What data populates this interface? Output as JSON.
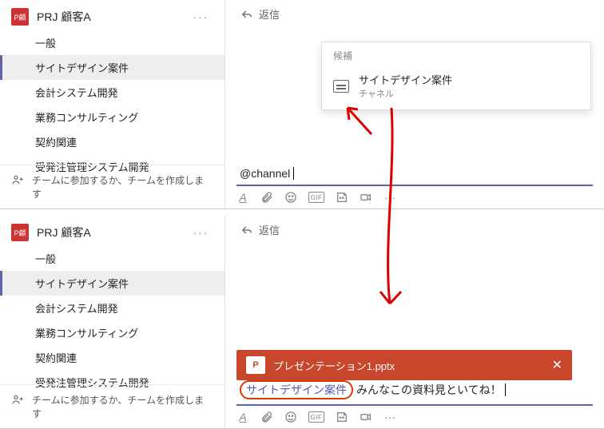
{
  "team": {
    "badge": "P顧",
    "name": "PRJ 顧客A",
    "more": "···"
  },
  "channels": [
    {
      "label": "一般",
      "selected": false
    },
    {
      "label": "サイトデザイン案件",
      "selected": true
    },
    {
      "label": "会計システム開発",
      "selected": false
    },
    {
      "label": "業務コンサルティング",
      "selected": false
    },
    {
      "label": "契約関連",
      "selected": false
    },
    {
      "label": "受発注管理システム開発",
      "selected": false
    }
  ],
  "join_create": "チームに参加するか、チームを作成します",
  "reply_label": "返信",
  "suggestion": {
    "header": "候補",
    "title": "サイトデザイン案件",
    "subtitle": "チャネル"
  },
  "compose_top": {
    "text": "@channel"
  },
  "compose_bottom": {
    "mention": "サイトデザイン案件",
    "rest": "みんなこの資料見といてね！"
  },
  "attachment": {
    "icon_text": "P",
    "filename": "プレゼンテーション1.pptx"
  },
  "toolbar": {
    "format": "A",
    "gif": "GIF",
    "more": "···"
  }
}
